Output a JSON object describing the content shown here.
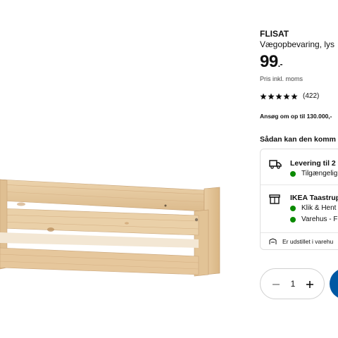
{
  "product": {
    "name": "FLISAT",
    "description": "Vægopbevaring, lys",
    "price": "99",
    "price_suffix": ".-",
    "vat_note": "Pris inkl. moms",
    "rating": 5,
    "rating_count": "(422)",
    "credit_note": "Ansøg om op til 130.000,-"
  },
  "delivery": {
    "section_title": "Sådan kan den komm",
    "home": {
      "title": "Levering til 2",
      "status": "Tilgængelig",
      "icon": "truck-icon"
    },
    "store": {
      "title": "IKEA Taastrup",
      "click_collect": "Klik & Hent",
      "warehouse": "Varehus - F",
      "icon": "store-icon"
    },
    "exhibit_note": "Er udstillet i varehu",
    "status_color": "#0a8a00"
  },
  "quantity": {
    "value": "1",
    "minus_icon": "minus-icon",
    "plus_icon": "plus-icon"
  },
  "colors": {
    "accent": "#0058a3",
    "wood": "#e3c49b"
  }
}
